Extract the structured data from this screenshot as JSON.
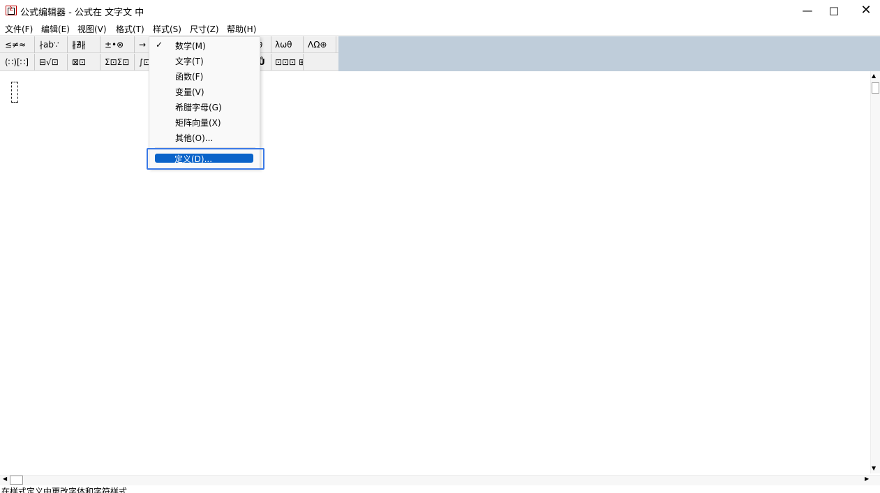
{
  "window": {
    "title": "公式编辑器 - 公式在 文字文 中",
    "minimize": "—",
    "maximize": "□",
    "close": "✕"
  },
  "menubar": {
    "items": [
      {
        "label": "文件(F)"
      },
      {
        "label": "编辑(E)"
      },
      {
        "label": "视图(V)"
      },
      {
        "label": "格式(T)"
      },
      {
        "label": "样式(S)"
      },
      {
        "label": "尺寸(Z)"
      },
      {
        "label": "帮助(H)"
      }
    ]
  },
  "palette": {
    "row1": [
      "≤≠≈",
      "∤ab∵",
      "∦∄∦",
      "±•⊗",
      "→",
      "λωθ",
      "ΛΩ⊛"
    ],
    "row2": [
      "(∷)[∷]",
      "⊟√⊡",
      "⊠⊡",
      "Σ⊡Σ⊡",
      "∫⊡",
      "⊡⊡⊡ ⊞"
    ],
    "hidden_glyph_r1": "∂",
    "hidden_glyph_r2": "Ů"
  },
  "style_menu": {
    "items": [
      {
        "label": "数学(M)",
        "checked": true
      },
      {
        "label": "文字(T)"
      },
      {
        "label": "函数(F)"
      },
      {
        "label": "变量(V)"
      },
      {
        "label": "希腊字母(G)"
      },
      {
        "label": "矩阵向量(X)"
      },
      {
        "label": "其他(O)..."
      }
    ],
    "checkmark": "✓",
    "highlighted": {
      "label": "定义(D)..."
    }
  },
  "scroll": {
    "up": "▲",
    "down": "▼",
    "left": "◀",
    "right": "▶"
  },
  "status": {
    "text": "在样式定义中更改字体和字符样式"
  },
  "colors": {
    "toolbar_bg": "#bfcdda",
    "highlight": "#0a63c9",
    "focus_outline": "#3a79e6"
  }
}
